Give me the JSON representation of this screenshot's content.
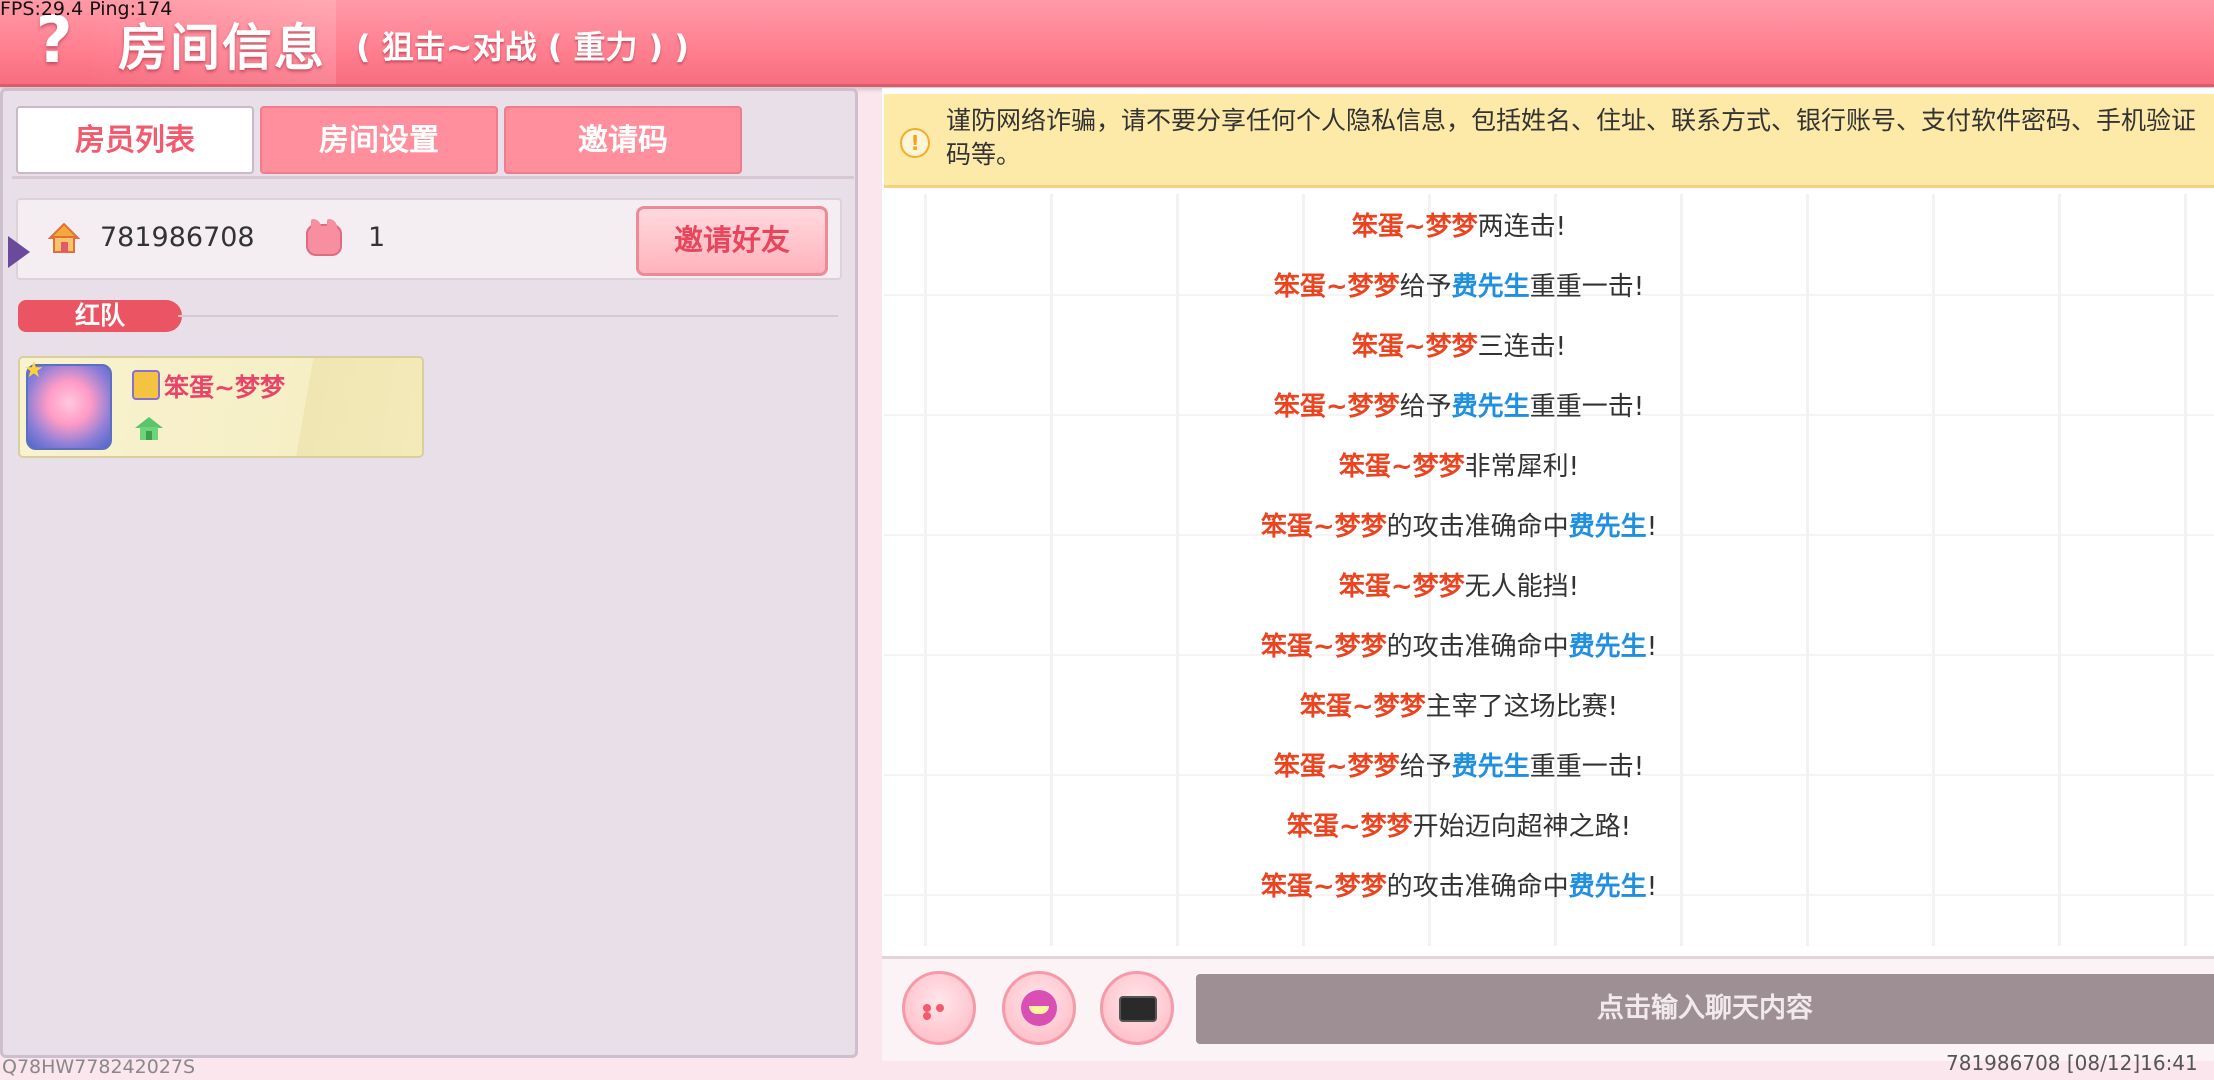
{
  "debug": {
    "fps_text": "FPS:29.4  Ping:174"
  },
  "header": {
    "help_glyph": "?",
    "title": "房间信息",
    "subtitle": "( 狙击~对战 ( 重力 ) )"
  },
  "tabs": [
    {
      "label": "房员列表",
      "active": true
    },
    {
      "label": "房间设置",
      "active": false
    },
    {
      "label": "邀请码",
      "active": false
    }
  ],
  "room": {
    "room_id": "781986708",
    "player_count": "1",
    "invite_label": "邀请好友"
  },
  "team": {
    "name": "红队",
    "players": [
      {
        "name": "笨蛋~梦梦",
        "is_host": true
      }
    ]
  },
  "left_footer": "Q78HW778242027S",
  "notice": {
    "icon": "!",
    "text": "谨防网络诈骗，请不要分享任何个人隐私信息，包括姓名、住址、联系方式、银行账号、支付软件密码、手机验证码等。"
  },
  "messages": [
    {
      "parts": [
        {
          "t": "笨蛋~梦梦",
          "c": "red"
        },
        {
          "t": "两连击!",
          "c": ""
        }
      ]
    },
    {
      "parts": [
        {
          "t": "笨蛋~梦梦",
          "c": "red"
        },
        {
          "t": "给予",
          "c": ""
        },
        {
          "t": "费先生",
          "c": "blue"
        },
        {
          "t": "重重一击!",
          "c": ""
        }
      ]
    },
    {
      "parts": [
        {
          "t": "笨蛋~梦梦",
          "c": "red"
        },
        {
          "t": "三连击!",
          "c": ""
        }
      ]
    },
    {
      "parts": [
        {
          "t": "笨蛋~梦梦",
          "c": "red"
        },
        {
          "t": "给予",
          "c": ""
        },
        {
          "t": "费先生",
          "c": "blue"
        },
        {
          "t": "重重一击!",
          "c": ""
        }
      ]
    },
    {
      "parts": [
        {
          "t": "笨蛋~梦梦",
          "c": "red"
        },
        {
          "t": "非常犀利!",
          "c": ""
        }
      ]
    },
    {
      "parts": [
        {
          "t": "笨蛋~梦梦",
          "c": "red"
        },
        {
          "t": "的攻击准确命中",
          "c": ""
        },
        {
          "t": "费先生",
          "c": "blue"
        },
        {
          "t": "!",
          "c": ""
        }
      ]
    },
    {
      "parts": [
        {
          "t": "笨蛋~梦梦",
          "c": "red"
        },
        {
          "t": "无人能挡!",
          "c": ""
        }
      ]
    },
    {
      "parts": [
        {
          "t": "笨蛋~梦梦",
          "c": "red"
        },
        {
          "t": "的攻击准确命中",
          "c": ""
        },
        {
          "t": "费先生",
          "c": "blue"
        },
        {
          "t": "!",
          "c": ""
        }
      ]
    },
    {
      "parts": [
        {
          "t": "笨蛋~梦梦",
          "c": "red"
        },
        {
          "t": "主宰了这场比赛!",
          "c": ""
        }
      ]
    },
    {
      "parts": [
        {
          "t": "笨蛋~梦梦",
          "c": "red"
        },
        {
          "t": "给予",
          "c": ""
        },
        {
          "t": "费先生",
          "c": "blue"
        },
        {
          "t": "重重一击!",
          "c": ""
        }
      ]
    },
    {
      "parts": [
        {
          "t": "笨蛋~梦梦",
          "c": "red"
        },
        {
          "t": "开始迈向超神之路!",
          "c": ""
        }
      ]
    },
    {
      "parts": [
        {
          "t": "笨蛋~梦梦",
          "c": "red"
        },
        {
          "t": "的攻击准确命中",
          "c": ""
        },
        {
          "t": "费先生",
          "c": "blue"
        },
        {
          "t": "!",
          "c": ""
        }
      ]
    }
  ],
  "chat_input": {
    "placeholder": "点击输入聊天内容"
  },
  "right_footer": "781986708   [08/12]16:41",
  "colors": {
    "accent": "#ff7f8f",
    "name_red": "#ea4420",
    "name_blue": "#1f8fde",
    "notice_bg": "#fde9a8"
  }
}
